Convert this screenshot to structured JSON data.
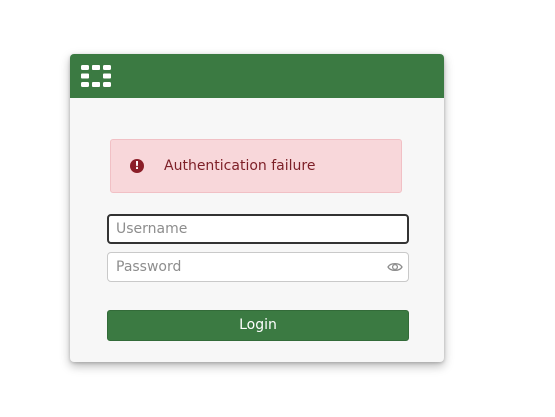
{
  "header": {
    "logo_icon": "fortinet-logo-icon",
    "background_color": "#3b7a42"
  },
  "alert": {
    "icon": "exclamation-circle-icon",
    "message": "Authentication failure",
    "background_color": "#f8d7da",
    "text_color": "#7d1f27"
  },
  "form": {
    "username": {
      "value": "",
      "placeholder": "Username"
    },
    "password": {
      "value": "",
      "placeholder": "Password",
      "toggle_icon": "eye-icon"
    },
    "login_label": "Login",
    "button_color": "#3b7a42"
  }
}
